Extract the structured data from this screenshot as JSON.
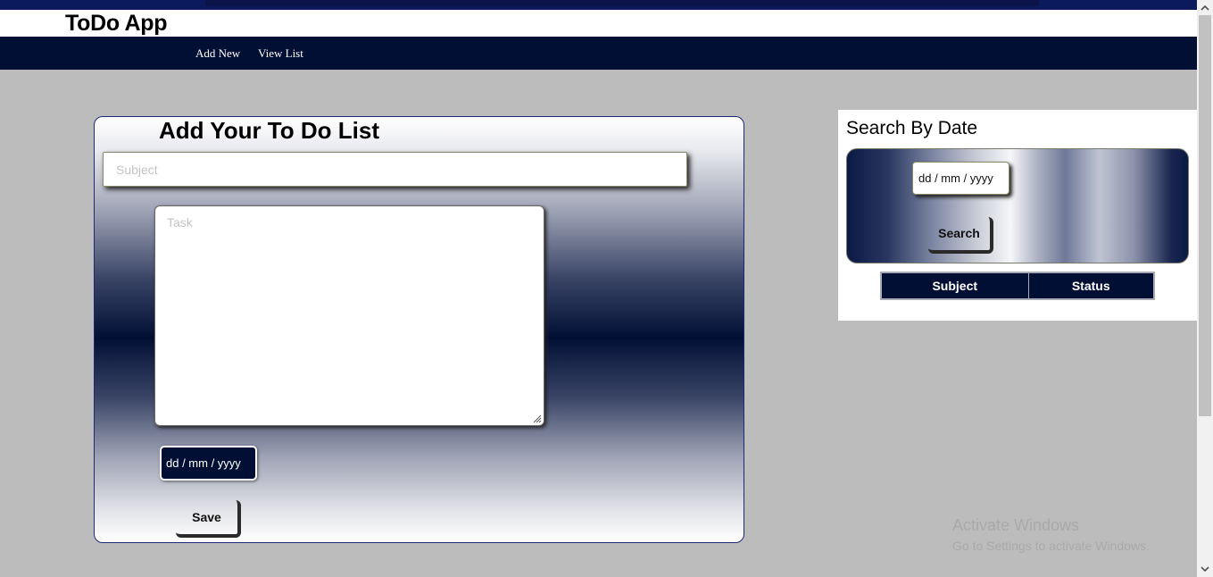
{
  "header": {
    "title": "ToDo App"
  },
  "nav": {
    "add_new": "Add New",
    "view_list": "View List"
  },
  "add_panel": {
    "title": "Add Your To Do List",
    "subject_placeholder": "Subject",
    "task_placeholder": "Task",
    "date_placeholder": "dd / mm / yyyy",
    "save_label": "Save"
  },
  "search_panel": {
    "title": "Search By Date",
    "date_placeholder": "dd / mm / yyyy",
    "search_label": "Search",
    "table_headers": [
      "Subject",
      "Status"
    ]
  },
  "watermark": {
    "title": "Activate Windows",
    "subtitle": "Go to Settings to activate Windows."
  },
  "scrollbar": {
    "up_icon": "chevron-up-icon",
    "down_icon": "chevron-down-icon"
  },
  "colors": {
    "navy": "#020f35",
    "page_bg": "#bcbcbc"
  }
}
